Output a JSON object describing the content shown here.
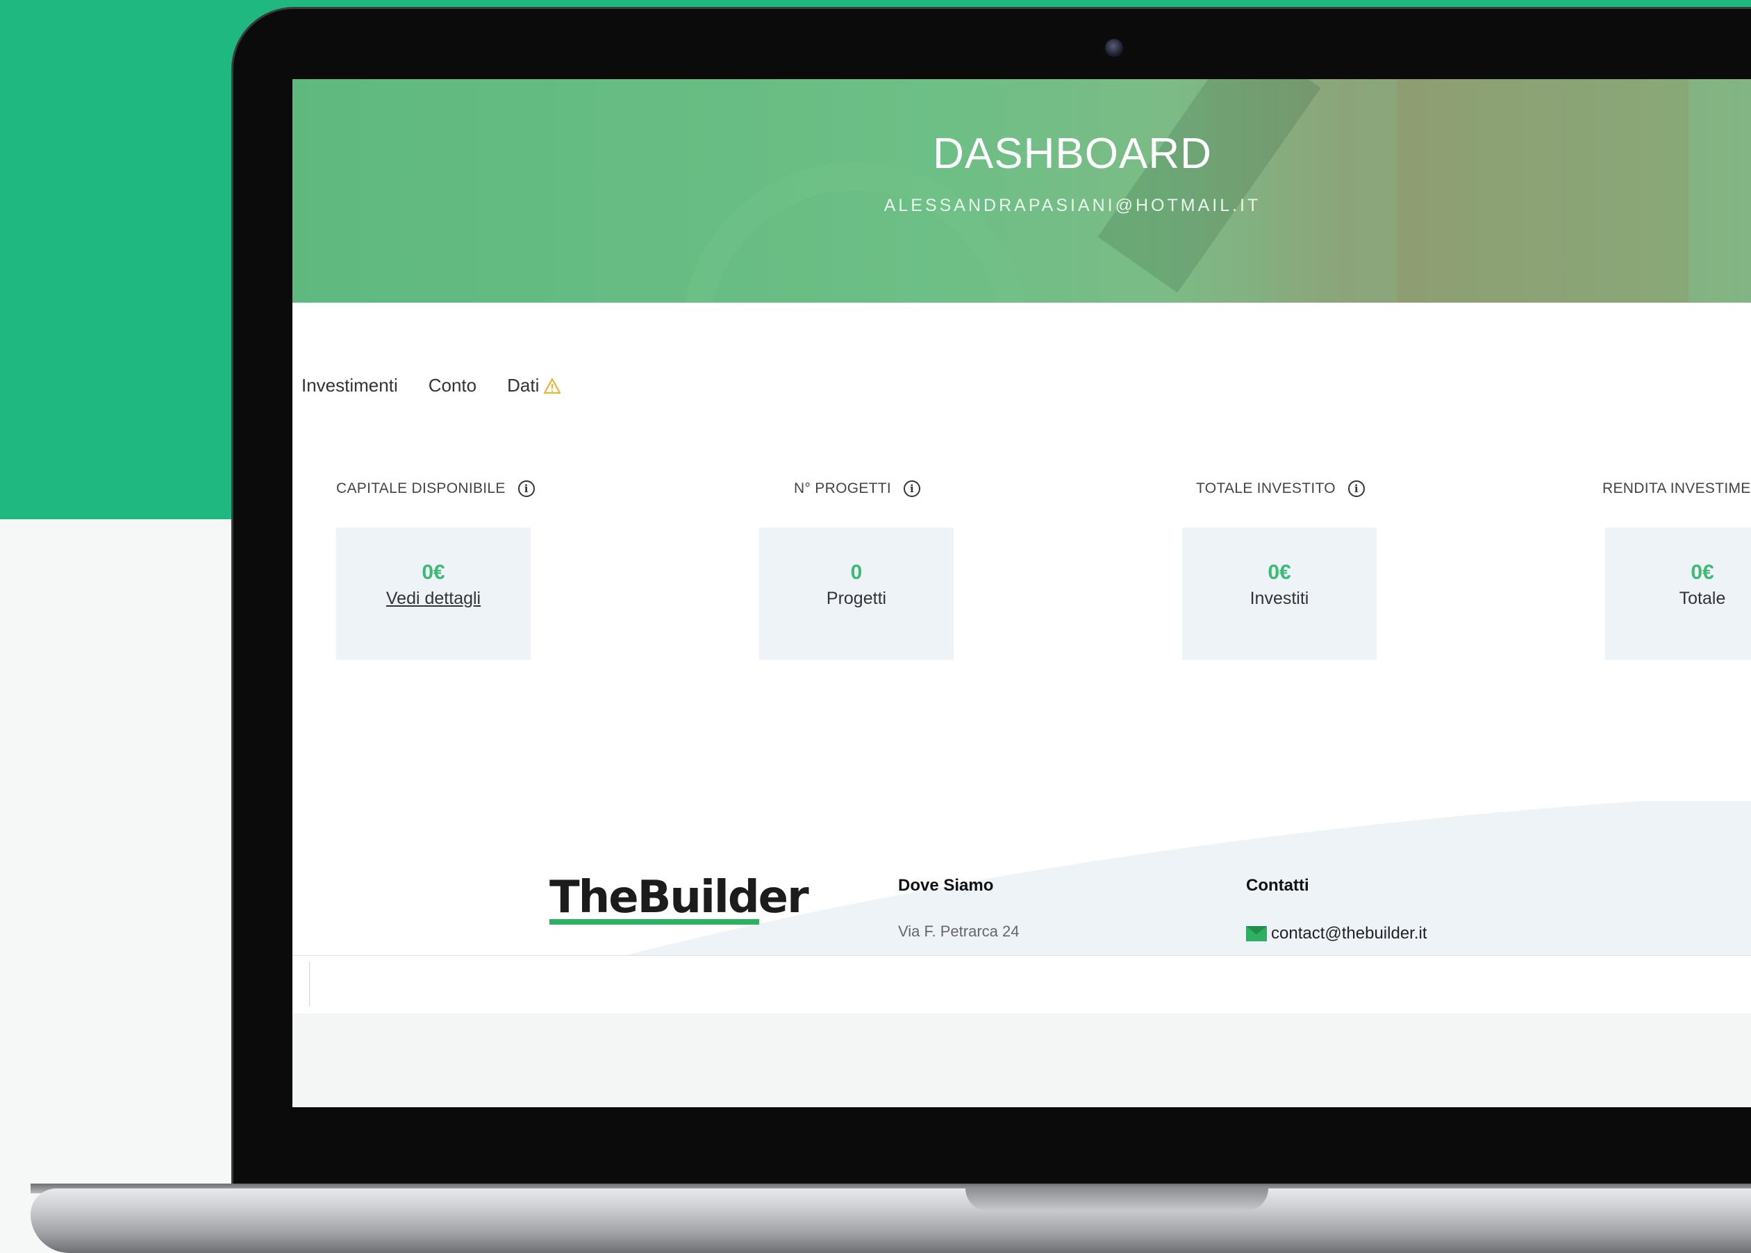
{
  "hero": {
    "title": "DASHBOARD",
    "email": "ALESSANDRAPASIANI@HOTMAIL.IT"
  },
  "tabs": [
    {
      "label": "Investimenti"
    },
    {
      "label": "Conto"
    },
    {
      "label": "Dati",
      "icon": "warning-icon"
    }
  ],
  "stats": [
    {
      "label": "CAPITALE DISPONIBILE",
      "value": "0€",
      "caption": "Vedi dettagli",
      "caption_is_link": true
    },
    {
      "label": "N° PROGETTI",
      "value": "0",
      "caption": "Progetti"
    },
    {
      "label": "TOTALE INVESTITO",
      "value": "0€",
      "caption": "Investiti"
    },
    {
      "label": "RENDITA INVESTIMEN",
      "value": "0€",
      "caption": "Totale"
    }
  ],
  "footer": {
    "logo_text": "TheBuilder",
    "location_heading": "Dove Siamo",
    "address": "Via F. Petrarca 24",
    "contacts_heading": "Contatti",
    "email": "contact@thebuilder.it"
  },
  "colors": {
    "brand_green": "#20b881",
    "value_green": "#3dbb75",
    "card_bg": "#eef3f8"
  }
}
